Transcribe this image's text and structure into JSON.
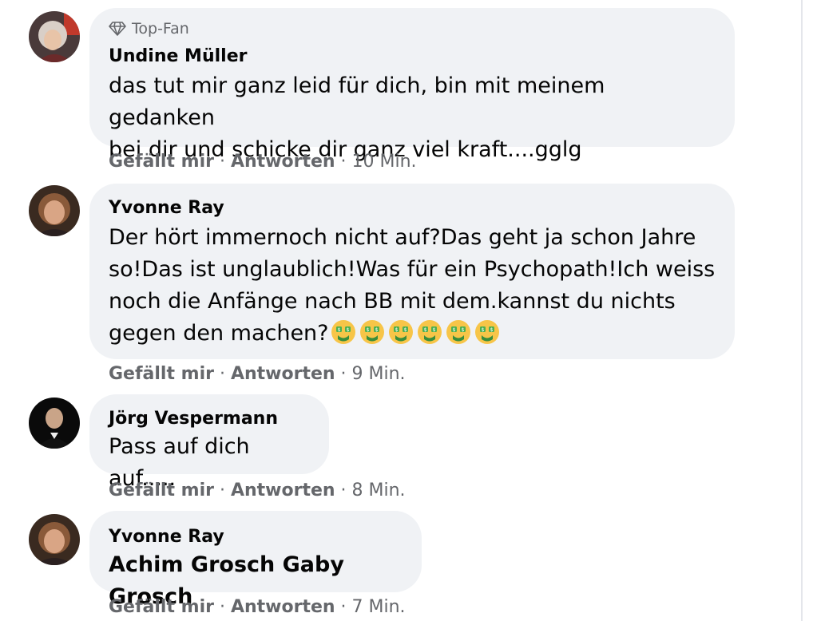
{
  "comments": [
    {
      "badge": "Top-Fan",
      "author": "Undine Müller",
      "text": "das tut mir ganz leid für dich, bin mit meinem gedanken\nbei dir und schicke dir ganz viel kraft....gglg",
      "like": "Gefällt mir",
      "reply": "Antworten",
      "time": "10 Min."
    },
    {
      "author": "Yvonne Ray",
      "text": "Der hört immernoch nicht auf?Das geht ja schon Jahre\nso!Das ist unglaublich!Was für ein Psychopath!Ich weiss\nnoch die Anfänge nach BB mit dem.kannst du nichts\ngegen den machen?",
      "emoji": "money-mouth-face",
      "emoji_count": 6,
      "like": "Gefällt mir",
      "reply": "Antworten",
      "time": "9 Min."
    },
    {
      "author": "Jörg Vespermann",
      "text": "Pass auf dich auf.....",
      "like": "Gefällt mir",
      "reply": "Antworten",
      "time": "8 Min."
    },
    {
      "author": "Yvonne Ray",
      "text": "Achim Grosch Gaby Grosch",
      "like": "Gefällt mir",
      "reply": "Antworten",
      "time": "7 Min."
    }
  ],
  "separator": " · ",
  "colors": {
    "bubble": "#f0f2f5",
    "secondary_text": "#65676b",
    "primary_text": "#050505"
  }
}
